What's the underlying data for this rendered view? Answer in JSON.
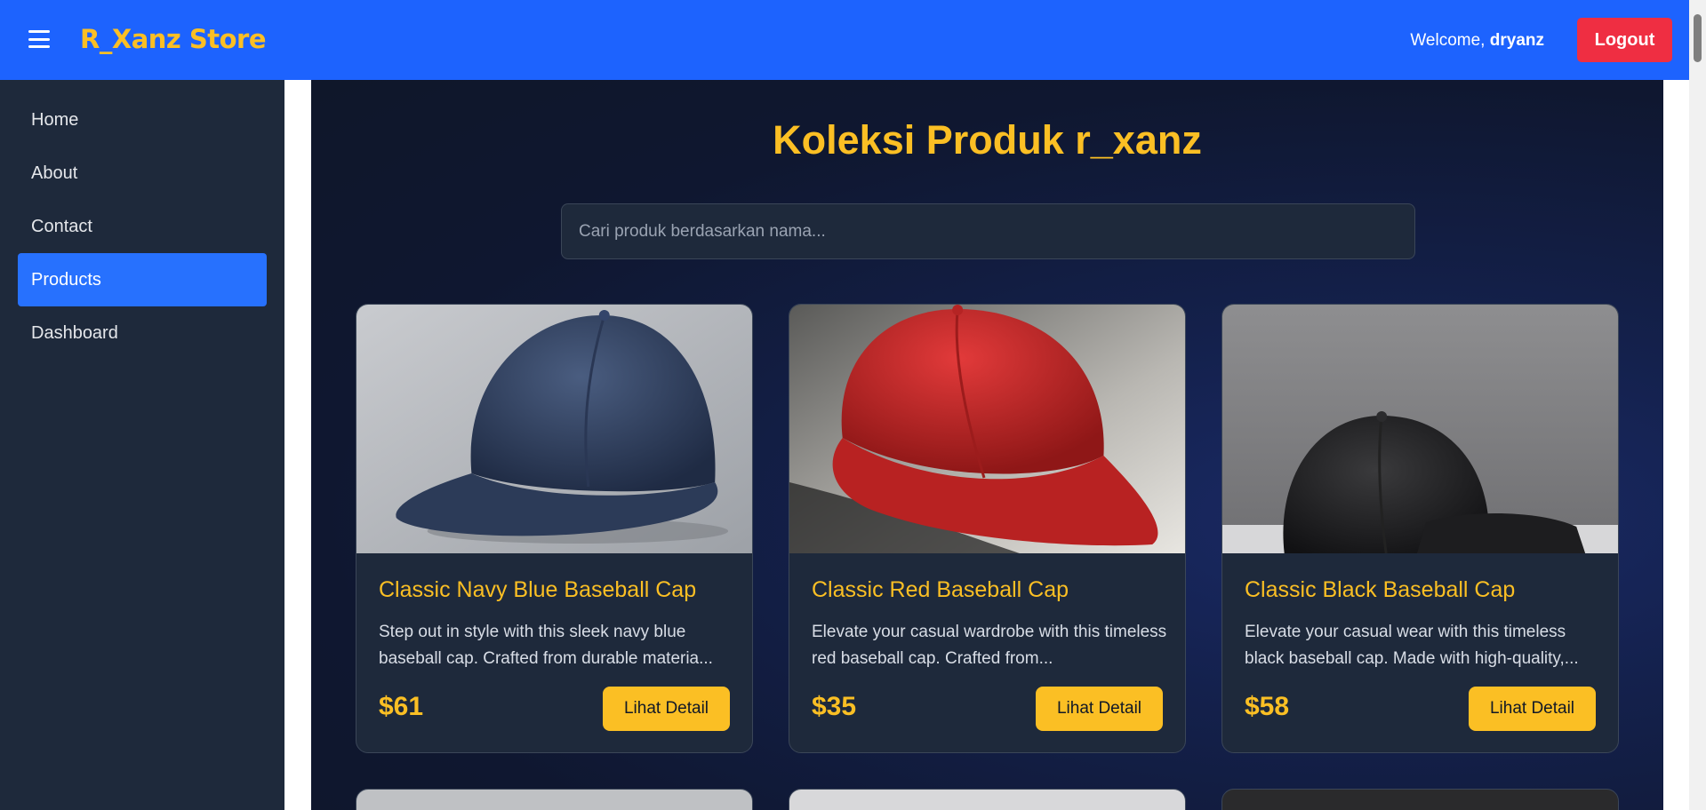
{
  "header": {
    "brand": "R_Xanz Store",
    "welcome_prefix": "Welcome, ",
    "username": "dryanz",
    "logout_label": "Logout"
  },
  "sidebar": {
    "items": [
      {
        "label": "Home"
      },
      {
        "label": "About"
      },
      {
        "label": "Contact"
      },
      {
        "label": "Products",
        "active": true
      },
      {
        "label": "Dashboard"
      }
    ]
  },
  "main": {
    "title": "Koleksi Produk r_xanz",
    "search_placeholder": "Cari produk berdasarkan nama...",
    "products": [
      {
        "name": "Classic Navy Blue Baseball Cap",
        "description": "Step out in style with this sleek navy blue baseball cap. Crafted from durable materia...",
        "price": "$61",
        "button": "Lihat Detail",
        "image": "navy-cap-icon"
      },
      {
        "name": "Classic Red Baseball Cap",
        "description": "Elevate your casual wardrobe with this timeless red baseball cap. Crafted from...",
        "price": "$35",
        "button": "Lihat Detail",
        "image": "red-cap-icon"
      },
      {
        "name": "Classic Black Baseball Cap",
        "description": "Elevate your casual wear with this timeless black baseball cap. Made with high-quality,...",
        "price": "$58",
        "button": "Lihat Detail",
        "image": "black-cap-icon"
      }
    ]
  },
  "colors": {
    "header": "#1d63fe",
    "accent": "#fbbf24",
    "logout": "#ef2e42",
    "sidebar": "#1e293b",
    "active_nav": "#2771fe"
  }
}
